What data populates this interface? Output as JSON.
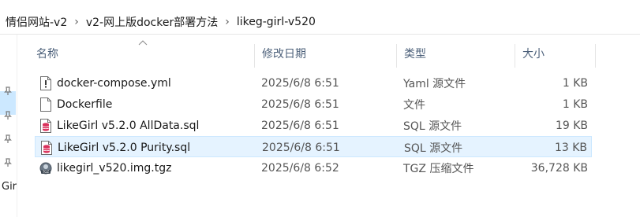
{
  "breadcrumb": [
    {
      "label": "情侣网站-v2"
    },
    {
      "label": "v2-网上版docker部署方法"
    },
    {
      "label": "likeg-girl-v520"
    }
  ],
  "nav": {
    "truncated_label": "Gir"
  },
  "columns": {
    "name": "名称",
    "date": "修改日期",
    "type": "类型",
    "size": "大小"
  },
  "files": [
    {
      "name": "docker-compose.yml",
      "date": "2025/6/8 6:51",
      "type": "Yaml 源文件",
      "size": "1 KB",
      "icon": "yaml-file-icon",
      "selected": false
    },
    {
      "name": "Dockerfile",
      "date": "2025/6/8 6:51",
      "type": "文件",
      "size": "1 KB",
      "icon": "generic-file-icon",
      "selected": false
    },
    {
      "name": "LikeGirl v5.2.0 AllData.sql",
      "date": "2025/6/8 6:51",
      "type": "SQL 源文件",
      "size": "19 KB",
      "icon": "sql-file-icon",
      "selected": false
    },
    {
      "name": "LikeGirl v5.2.0 Purity.sql",
      "date": "2025/6/8 6:51",
      "type": "SQL 源文件",
      "size": "13 KB",
      "icon": "sql-file-icon",
      "selected": true
    },
    {
      "name": "likegirl_v520.img.tgz",
      "date": "2025/6/8 6:52",
      "type": "TGZ 压缩文件",
      "size": "36,728 KB",
      "icon": "tgz-archive-icon",
      "selected": false
    }
  ],
  "colors": {
    "selection_bg": "#e5f3ff",
    "selection_border": "#cce8ff",
    "header_text": "#4c607a"
  }
}
